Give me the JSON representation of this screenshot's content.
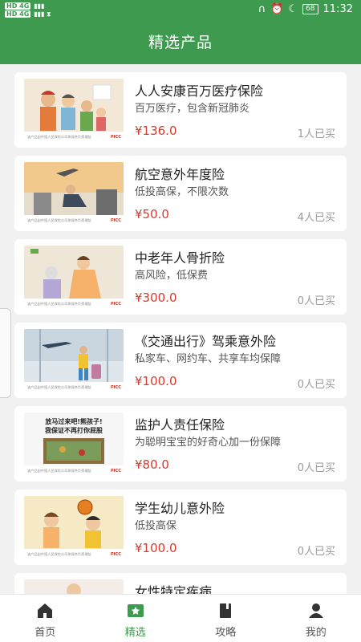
{
  "status": {
    "network_1": "HD 4G",
    "network_2": "HD 4G",
    "battery": "68",
    "time": "11:32"
  },
  "header": {
    "title": "精选产品"
  },
  "products": [
    {
      "title": "人人安康百万医疗保险",
      "subtitle": "百万医疗，包含新冠肺炎",
      "price": "¥136.0",
      "sold": "1人已买",
      "banner_note": "该产品由中国人民保险公司承保并负责理赔",
      "brand": "PICC"
    },
    {
      "title": "航空意外年度险",
      "subtitle": "低投高保，不限次数",
      "price": "¥50.0",
      "sold": "4人已买",
      "banner_note": "该产品由中国人民保险公司承保并负责理赔",
      "brand": "PICC"
    },
    {
      "title": "中老年人骨折险",
      "subtitle": "高风险，低保费",
      "price": "¥300.0",
      "sold": "0人已买",
      "banner_note": "该产品由中国人民保险公司承保并负责理赔",
      "brand": "PICC"
    },
    {
      "title": "《交通出行》驾乘意外险",
      "subtitle": "私家车、网约车、共享车均保障",
      "price": "¥100.0",
      "sold": "0人已买",
      "banner_note": "该产品由中国人民保险公司承保并负责理赔",
      "brand": "PICC"
    },
    {
      "title": "监护人责任保险",
      "subtitle": "为聪明宝宝的好奇心加一份保障",
      "price": "¥80.0",
      "sold": "0人已买",
      "banner_note": "该产品由中国人民保险公司承保并负责理赔",
      "brand": "PICC",
      "banner_line1": "放马过来吧!熊孩子!",
      "banner_line2": "我保证不再打你屁股"
    },
    {
      "title": "学生幼儿意外险",
      "subtitle": "低投高保",
      "price": "¥100.0",
      "sold": "0人已买",
      "banner_note": "该产品由中国人民保险公司承保并负责理赔",
      "brand": "PICC"
    },
    {
      "title": "女性特定疾病",
      "subtitle": "",
      "price": "",
      "sold": ""
    }
  ],
  "tabs": [
    {
      "label": "首页",
      "icon": "home-icon"
    },
    {
      "label": "精选",
      "icon": "star-badge-icon",
      "active": true
    },
    {
      "label": "攻略",
      "icon": "book-icon"
    },
    {
      "label": "我的",
      "icon": "person-icon"
    }
  ],
  "colors": {
    "brand_green": "#3e9a4f",
    "price_red": "#d43a2e"
  }
}
